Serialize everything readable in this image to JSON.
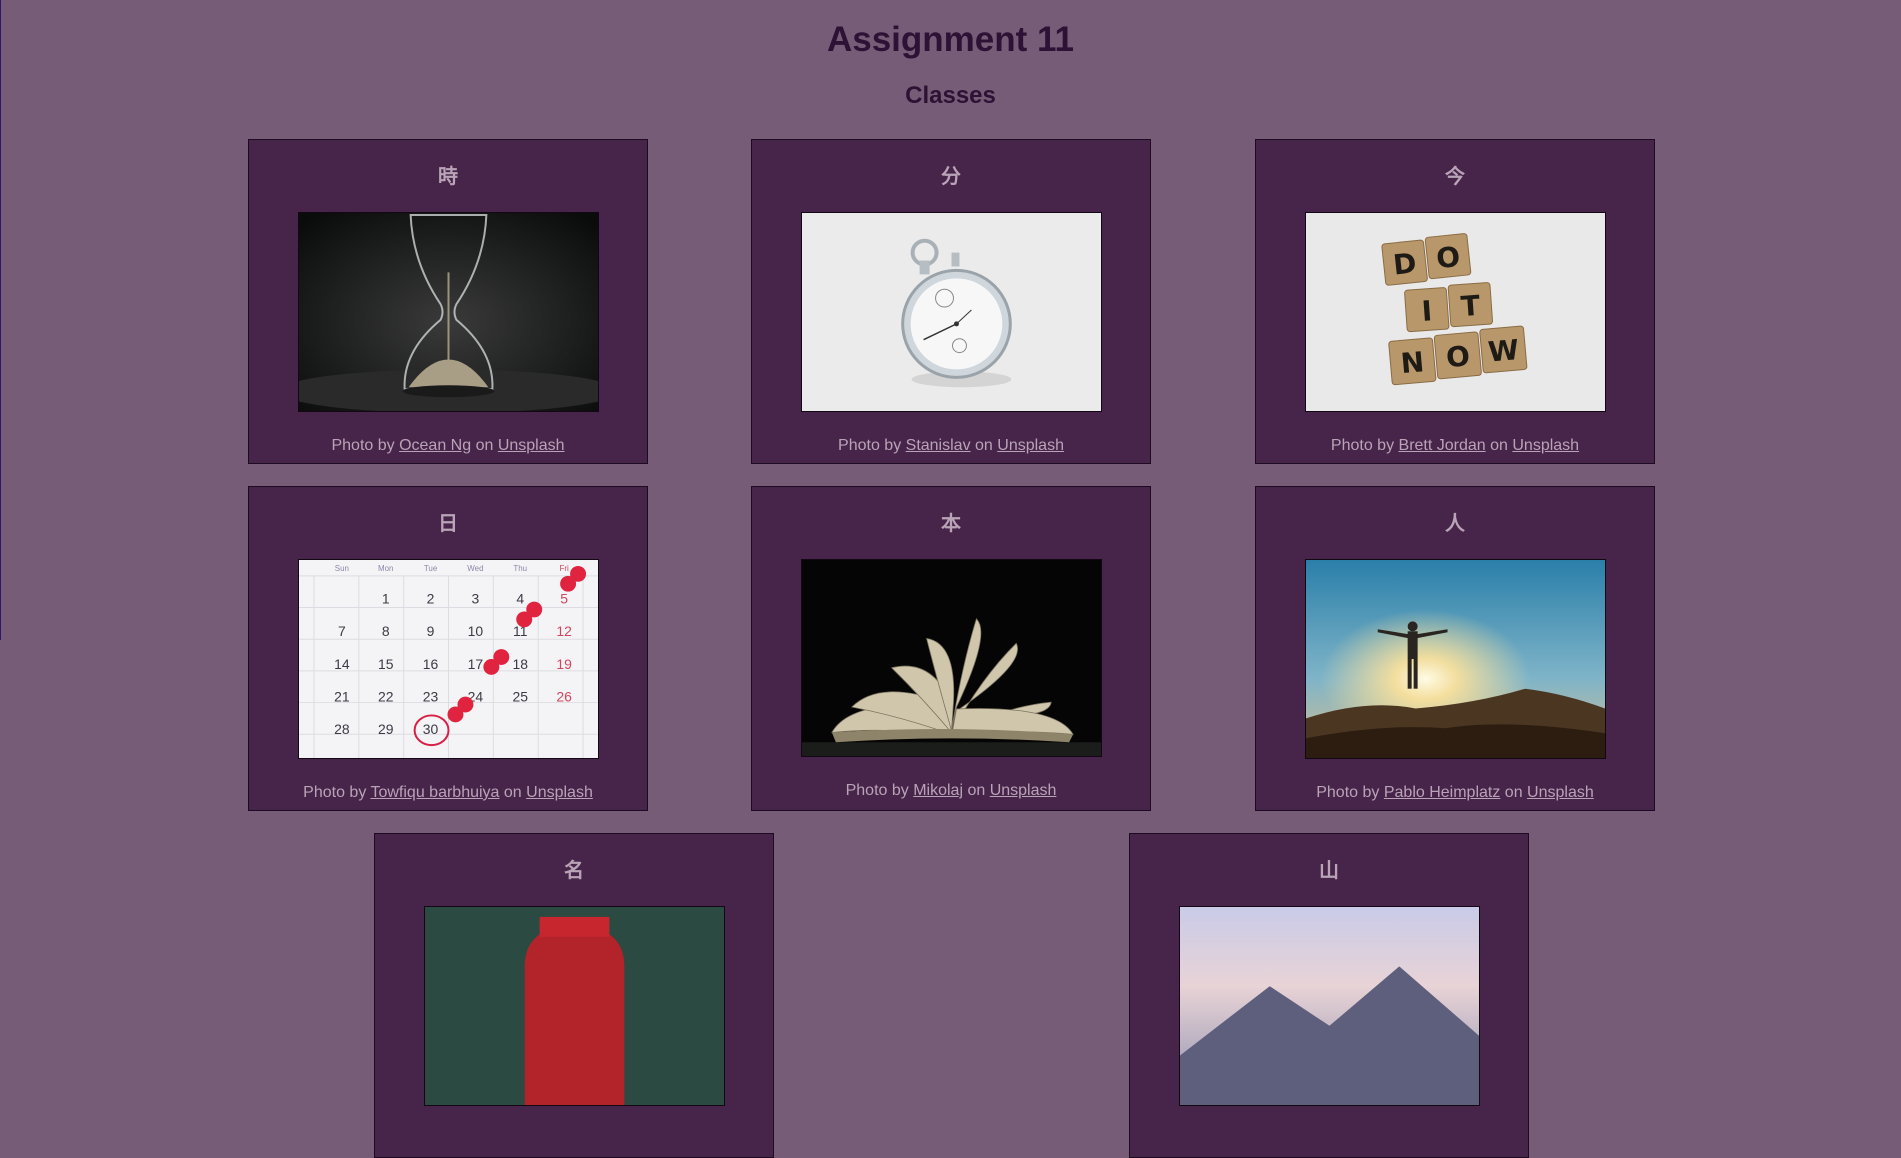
{
  "header": {
    "title": "Assignment 11",
    "subtitle": "Classes"
  },
  "cards": [
    {
      "kanji": "時",
      "photo_icon": "hourglass-photo",
      "credit_prefix": "Photo by",
      "author": "Ocean Ng",
      "credit_mid": "on",
      "site": "Unsplash"
    },
    {
      "kanji": "分",
      "photo_icon": "stopwatch-photo",
      "credit_prefix": "Photo by",
      "author": "Stanislav",
      "credit_mid": "on",
      "site": "Unsplash"
    },
    {
      "kanji": "今",
      "photo_icon": "do-it-now-tiles-photo",
      "credit_prefix": "Photo by",
      "author": "Brett Jordan",
      "credit_mid": "on",
      "site": "Unsplash"
    },
    {
      "kanji": "日",
      "photo_icon": "calendar-photo",
      "credit_prefix": "Photo by",
      "author": "Towfiqu barbhuiya",
      "credit_mid": "on",
      "site": "Unsplash"
    },
    {
      "kanji": "本",
      "photo_icon": "open-book-photo",
      "credit_prefix": "Photo by",
      "author": "Mikolaj",
      "credit_mid": "on",
      "site": "Unsplash"
    },
    {
      "kanji": "人",
      "photo_icon": "person-sunrise-photo",
      "credit_prefix": "Photo by",
      "author": "Pablo Heimplatz",
      "credit_mid": "on",
      "site": "Unsplash"
    },
    {
      "kanji": "名",
      "photo_icon": "name-photo"
    },
    {
      "kanji": "山",
      "photo_icon": "mountain-sky-photo"
    }
  ],
  "calendar": {
    "days": [
      "Sun",
      "Mon",
      "Tue",
      "Wed",
      "Thu",
      "Fri"
    ],
    "rows": [
      [
        "",
        "1",
        "2",
        "3",
        "4",
        "5"
      ],
      [
        "7",
        "8",
        "9",
        "10",
        "11",
        "12"
      ],
      [
        "14",
        "15",
        "16",
        "17",
        "18",
        "19"
      ],
      [
        "21",
        "22",
        "23",
        "24",
        "25",
        "26"
      ],
      [
        "28",
        "29",
        "30",
        "",
        "",
        ""
      ]
    ]
  },
  "tiles": {
    "row1": [
      "D",
      "O"
    ],
    "row2": [
      "I",
      "T"
    ],
    "row3": [
      "N",
      "O",
      "W"
    ]
  },
  "colors": {
    "page_bg": "#765c77",
    "card_bg": "#47244a",
    "heading": "#2e1236",
    "card_text": "#b9a3b6"
  }
}
